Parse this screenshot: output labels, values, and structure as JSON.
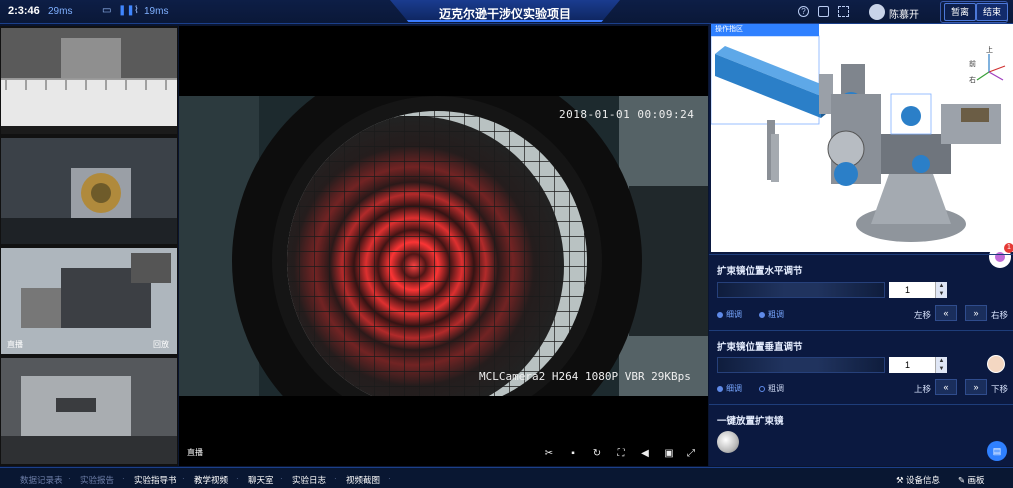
{
  "header": {
    "clock": "2:3:46",
    "latency_1": "29ms",
    "latency_2": "19ms",
    "title": "迈克尔逊干涉仪实验项目",
    "user_name": "陈慕开",
    "btn_leave": "暂离",
    "btn_end": "结束"
  },
  "thumbs": [
    {
      "label": "",
      "label2": ""
    },
    {
      "label": "",
      "label2": ""
    },
    {
      "label": "直播",
      "label2": "回放"
    },
    {
      "label": "",
      "label2": ""
    }
  ],
  "video": {
    "osd_time": "2018-01-01  00:09:24",
    "osd_cam": "MCLCamera2 H264 1080P VBR 29KBps",
    "live_label": "直播"
  },
  "right": {
    "model_tab": "操作指区",
    "axis_labels": {
      "up": "上",
      "front": "前",
      "right": "右"
    },
    "h_section": {
      "title": "扩束镜位置水平调节",
      "value": "1",
      "radio_fine": "细调",
      "radio_coarse": "粗调",
      "left_label": "左移",
      "right_label": "右移",
      "btn_left": "«",
      "btn_right": "»"
    },
    "v_section": {
      "title": "扩束镜位置垂直调节",
      "value": "1",
      "radio_fine": "细调",
      "radio_coarse": "粗调",
      "up_label": "上移",
      "down_label": "下移",
      "btn_up": "«",
      "btn_down": "»"
    },
    "one_key": {
      "title": "一键放置扩束镜"
    },
    "badge_count": "1"
  },
  "footer": {
    "items": [
      {
        "label": "数据记录表",
        "dim": true
      },
      {
        "label": "实验报告",
        "dim": true
      },
      {
        "label": "实验指导书",
        "dim": false
      },
      {
        "label": "教学视频",
        "dim": false
      },
      {
        "label": "聊天室",
        "dim": false
      },
      {
        "label": "实验日志",
        "dim": false
      },
      {
        "label": "视频截图",
        "dim": false
      }
    ],
    "device_info": "设备信息",
    "canvas": "画板"
  },
  "colors": {
    "accent": "#2f80ff",
    "bg": "#0a1530",
    "panel": "#0b1940"
  }
}
